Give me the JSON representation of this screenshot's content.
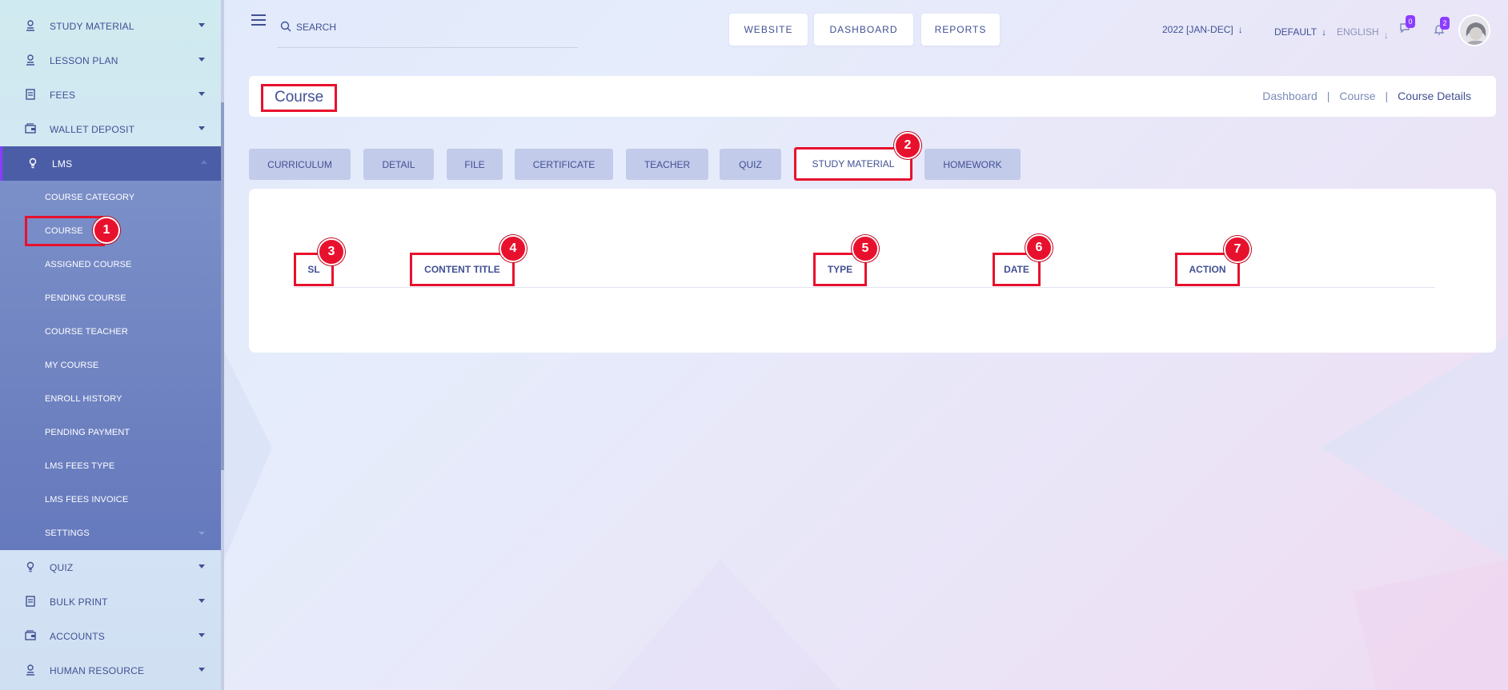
{
  "sidebar": {
    "items_top": [
      {
        "label": "STUDY MATERIAL",
        "icon": "person-icon"
      },
      {
        "label": "LESSON PLAN",
        "icon": "person-icon"
      },
      {
        "label": "FEES",
        "icon": "document-icon"
      },
      {
        "label": "WALLET DEPOSIT",
        "icon": "wallet-icon"
      },
      {
        "label": "LMS",
        "icon": "bulb-icon"
      }
    ],
    "lms_submenu": [
      "COURSE CATEGORY",
      "COURSE",
      "ASSIGNED COURSE",
      "PENDING COURSE",
      "COURSE TEACHER",
      "MY COURSE",
      "ENROLL HISTORY",
      "PENDING PAYMENT",
      "LMS FEES TYPE",
      "LMS FEES INVOICE",
      "SETTINGS"
    ],
    "items_bottom": [
      {
        "label": "QUIZ",
        "icon": "bulb-icon"
      },
      {
        "label": "BULK PRINT",
        "icon": "document-icon"
      },
      {
        "label": "ACCOUNTS",
        "icon": "wallet-icon"
      },
      {
        "label": "HUMAN RESOURCE",
        "icon": "person-icon"
      }
    ]
  },
  "header": {
    "search_placeholder": "SEARCH",
    "buttons": [
      "WEBSITE",
      "DASHBOARD",
      "REPORTS"
    ],
    "session": "2022 [JAN-DEC]",
    "theme": "DEFAULT",
    "language": "ENGLISH",
    "message_count": "0",
    "notification_count": "2"
  },
  "page": {
    "title": "Course",
    "breadcrumb": [
      "Dashboard",
      "Course",
      "Course Details"
    ]
  },
  "tabs": [
    "CURRICULUM",
    "DETAIL",
    "FILE",
    "CERTIFICATE",
    "TEACHER",
    "QUIZ",
    "STUDY MATERIAL",
    "HOMEWORK"
  ],
  "selected_tab": "STUDY MATERIAL",
  "table": {
    "columns": [
      "SL",
      "CONTENT TITLE",
      "TYPE",
      "DATE",
      "ACTION"
    ]
  },
  "markers": [
    "1",
    "2",
    "3",
    "4",
    "5",
    "6",
    "7"
  ],
  "colors": {
    "accent": "#415094",
    "highlight": "#e8112d",
    "active_menu": "#4b5da6",
    "badge": "#8b3dff"
  }
}
